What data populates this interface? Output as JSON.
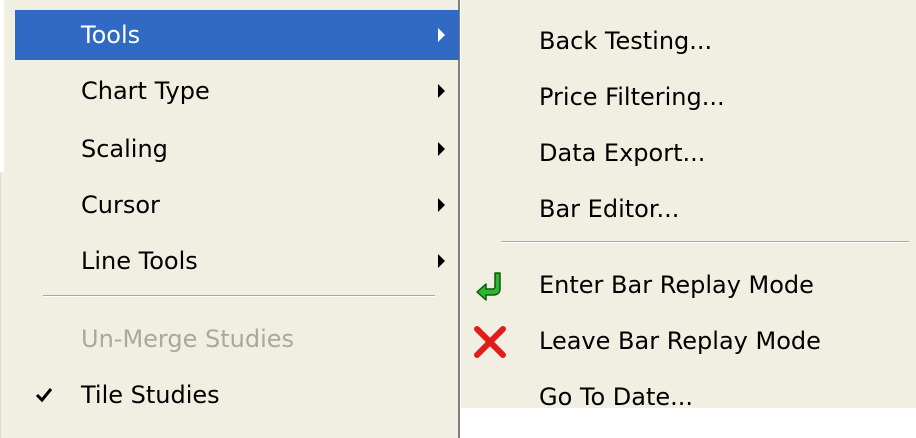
{
  "main_menu": {
    "items": [
      {
        "label": "Tools",
        "selected": true,
        "has_submenu": true
      },
      {
        "label": "Chart Type",
        "has_submenu": true
      },
      {
        "label": "Scaling",
        "has_submenu": true
      },
      {
        "label": "Cursor",
        "has_submenu": true
      },
      {
        "label": "Line Tools",
        "has_submenu": true
      },
      {
        "label": "Un-Merge Studies",
        "disabled": true
      },
      {
        "label": "Tile Studies",
        "checked": true
      }
    ]
  },
  "submenu": {
    "items": [
      {
        "label": "Back Testing..."
      },
      {
        "label": "Price Filtering..."
      },
      {
        "label": "Data Export..."
      },
      {
        "label": "Bar Editor..."
      },
      {
        "label": "Enter Bar Replay Mode",
        "icon": "green-return-arrow-icon"
      },
      {
        "label": "Leave Bar Replay Mode",
        "icon": "red-x-icon"
      },
      {
        "label": "Go To Date..."
      }
    ]
  },
  "colors": {
    "menu_bg": "#f1efe2",
    "highlight": "#316ac5",
    "disabled_text": "#aca899"
  }
}
